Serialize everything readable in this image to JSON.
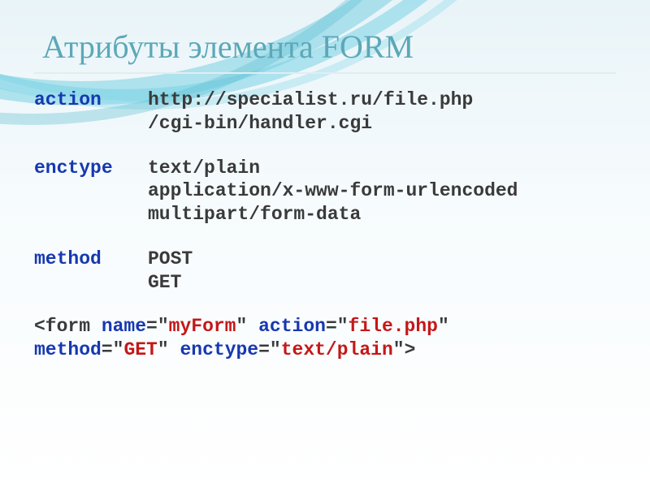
{
  "title": "Атрибуты элемента FORM",
  "rows": [
    {
      "name": "action",
      "values": [
        "http://specialist.ru/file.php",
        "/cgi-bin/handler.cgi"
      ]
    },
    {
      "name": "enctype",
      "values": [
        "text/plain",
        "application/x-www-form-urlencoded",
        "multipart/form-data"
      ]
    },
    {
      "name": "method",
      "values": [
        "POST",
        "GET"
      ]
    }
  ],
  "example": {
    "open": "<form ",
    "pairs": [
      {
        "k": "name",
        "v": "myForm"
      },
      {
        "k": "action",
        "v": "file.php"
      },
      {
        "k": "method",
        "v": "GET"
      },
      {
        "k": "enctype",
        "v": "text/plain"
      }
    ],
    "close": ">",
    "breakAfter": 2
  }
}
